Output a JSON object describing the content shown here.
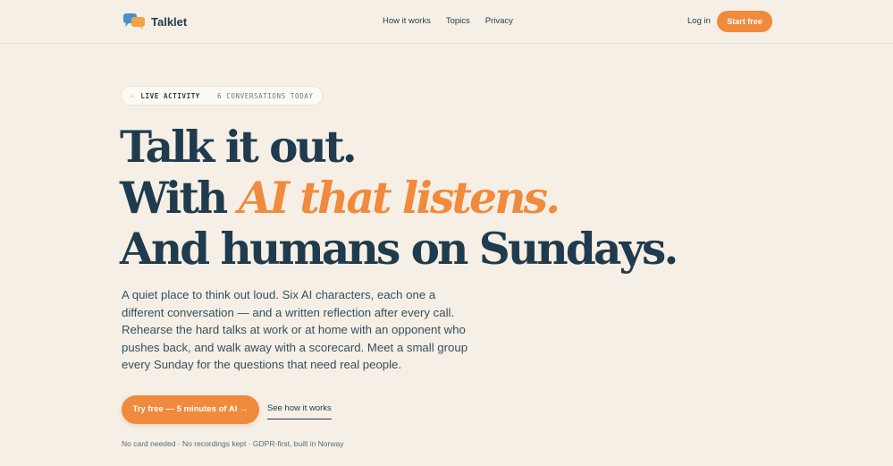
{
  "brand": {
    "name": "Talklet",
    "colors": {
      "accent": "#f08a3c",
      "ink": "#1f3b4d",
      "blue": "#4a8fd0",
      "background": "#f5efe5"
    }
  },
  "nav": {
    "links": [
      "How it works",
      "Topics",
      "Privacy"
    ],
    "login": "Log in",
    "cta": "Start free"
  },
  "badge": {
    "icon": "lightning-icon",
    "label": "LIVE ACTIVITY",
    "separator": "·",
    "count": "6 CONVERSATIONS TODAY"
  },
  "hero": {
    "line1": "Talk it out.",
    "line2_lead": "With ",
    "line2_accent": "AI that listens.",
    "line3": "And humans on Sundays.",
    "lede": "A quiet place to think out loud. Six AI characters, each one a different conversation — and a written reflection after every call. Rehearse the hard talks at work or at home with an opponent who pushes back, and walk away with a scorecard. Meet a small group every Sunday for the questions that need real people.",
    "primary_cta": "Try free — 5 minutes of AI →",
    "secondary_cta": "See how it works",
    "fineprint": "No card needed · No recordings kept · GDPR-first, built in Norway"
  }
}
